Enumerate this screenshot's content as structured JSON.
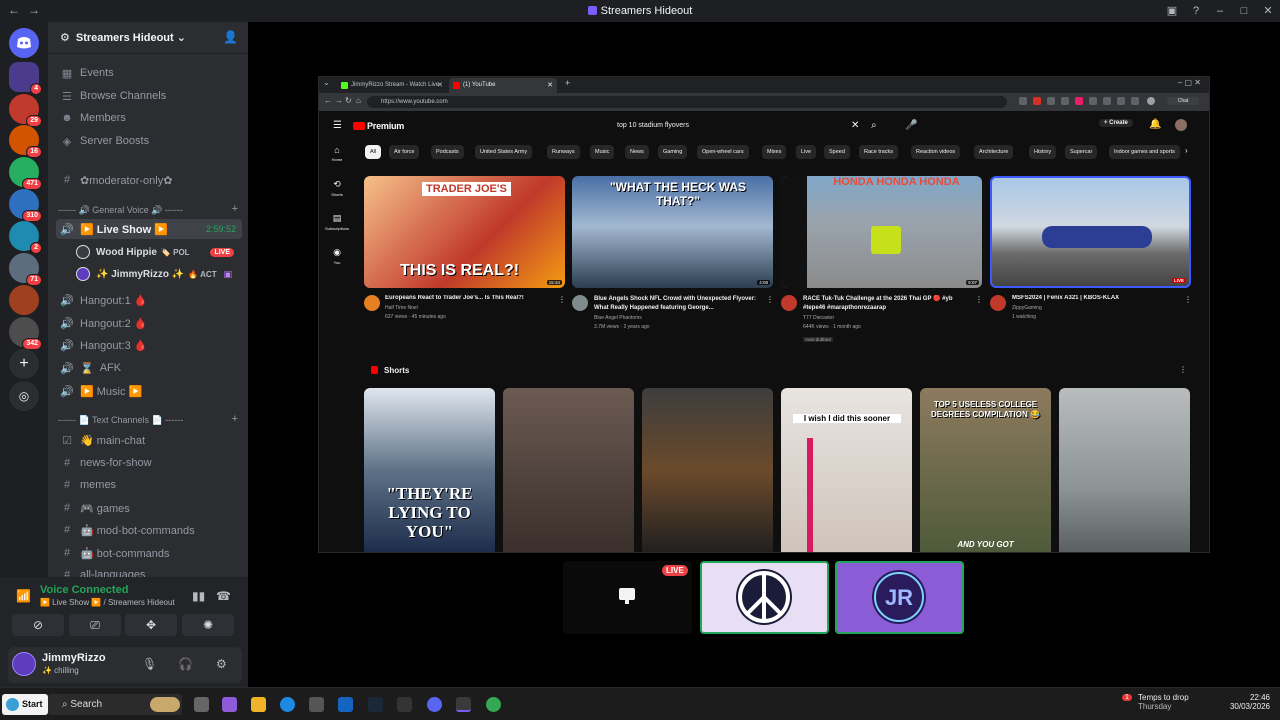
{
  "window": {
    "title": "Streamers Hideout"
  },
  "server": {
    "name": "Streamers Hideout",
    "badges": [
      "4",
      "29",
      "16",
      "471",
      "310",
      "2",
      "71",
      "342"
    ]
  },
  "sidebar": {
    "top_items": [
      "Events",
      "Browse Channels",
      "Members",
      "Server Boosts"
    ],
    "moderator_channel": "✿moderator-only✿",
    "voice_category": "------ 🔊 General Voice 🔊 ------",
    "live_show": {
      "label": "▶️ Live Show ▶️",
      "timer": "2:59:52"
    },
    "users": [
      {
        "name": "Wood Hippie",
        "tag": "🏷️ POL",
        "live": "LIVE"
      },
      {
        "name": "✨ JimmyRizzo ✨",
        "tag": "🔥 ACT"
      }
    ],
    "voice_channels": [
      "Hangout:1 🩸",
      "Hangout:2 🩸",
      "Hangout:3 🩸",
      "AFK",
      "▶️ Music ▶️"
    ],
    "text_category": "------ 📄 Text Channels 📄 ------",
    "text_channels": [
      "👋 main-chat",
      "news-for-show",
      "memes",
      "🎮 games",
      "🤖 mod-bot-commands",
      "🤖 bot-commands",
      "all-languages"
    ]
  },
  "voice_panel": {
    "status": "Voice Connected",
    "location": "▶️ Live Show ▶️ / Streamers Hideout",
    "user_name": "JimmyRizzo",
    "user_status": "✨ chilling"
  },
  "browser": {
    "tabs": [
      "JimmyRizzo Stream - Watch Live",
      "(1) YouTube"
    ],
    "url": "https://www.youtube.com",
    "logo": "Premium",
    "search_query": "top 10 stadium flyovers",
    "create_label": "+ Create",
    "notif_count": "9",
    "side_nav": [
      "Home",
      "Shorts",
      "Subscriptions",
      "You"
    ],
    "chips": [
      "All",
      "Air force",
      "Podcasts",
      "United States Army",
      "Runways",
      "Music",
      "News",
      "Gaming",
      "Open-wheel cars",
      "Mixes",
      "Live",
      "Speed",
      "Race tracks",
      "Reaction videos",
      "Architecture",
      "History",
      "Supercar",
      "Indoor games and sports"
    ],
    "videos": [
      {
        "title": "Europeans React to Trader Joe's... Is This Real?!",
        "channel": "Half Time Noel",
        "meta": "637 views · 45 minutes ago",
        "duration": "15:34",
        "thumb_top": "TRADER JOE'S",
        "thumb_bottom": "THIS IS REAL?!"
      },
      {
        "title": "Blue Angels Shock NFL Crowd with Unexpected Flyover: What Really Happened featuring George...",
        "channel": "Blue Angel Phantoms",
        "meta": "3.7M views · 2 years ago",
        "duration": "4:08",
        "thumb_top": "\"WHAT THE HECK WAS THAT?\""
      },
      {
        "title": "RACE Tuk-Tuk Challenge at the 2026 Thai GP 🔴 #yb #tepe46 #marapthonrezaarap",
        "channel": "T77 Diecaster",
        "meta": "644K views · 1 month ago",
        "duration": "6:07",
        "dub": "Auto-dubbed",
        "thumb_top": "HONDA HONDA HONDA"
      },
      {
        "title": "MSFS2024 | Fenix A321 | KBOS-KLAX",
        "channel": "ZippyGaming",
        "meta": "1 watching",
        "live": "LIVE"
      }
    ],
    "shorts_label": "Shorts",
    "shorts": [
      {
        "caption": "\"THEY'RE LYING TO YOU\""
      },
      {
        "caption": ""
      },
      {
        "caption": ""
      },
      {
        "caption": "I wish I did this sooner"
      },
      {
        "caption": "TOP 5 USELESS COLLEGE DEGREES COMPILATION 😂",
        "caption2": "AND YOU GOT"
      },
      {
        "caption": ""
      }
    ]
  },
  "stage": {
    "live_badge": "LIVE"
  },
  "taskbar": {
    "start": "Start",
    "search": "Search",
    "weather": "Temps to drop",
    "weather_day": "Thursday",
    "weather_badge": "1",
    "time": "22:46",
    "date": "30/03/2026"
  },
  "colors": {
    "discord_bg": "#2b2d31",
    "rail_bg": "#1e1f22",
    "voice_green": "#23a55a",
    "live_red": "#ed4245",
    "yt_bg": "#0f0f0f"
  }
}
